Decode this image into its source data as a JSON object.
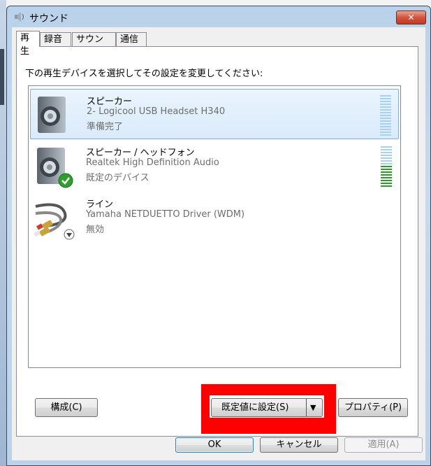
{
  "window": {
    "title": "サウンド",
    "close_label": "✕"
  },
  "tabs": [
    {
      "label": "再生",
      "active": true
    },
    {
      "label": "録音",
      "active": false
    },
    {
      "label": "サウンド",
      "active": false
    },
    {
      "label": "通信",
      "active": false
    }
  ],
  "instruction": "下の再生デバイスを選択してその設定を変更してください:",
  "devices": [
    {
      "name": "スピーカー",
      "description": "2- Logicool USB Headset H340",
      "status": "準備完了",
      "icon": "speaker-icon",
      "selected": true,
      "level": 0
    },
    {
      "name": "スピーカー / ヘッドフォン",
      "description": "Realtek High Definition Audio",
      "status": "既定のデバイス",
      "icon": "speaker-icon",
      "selected": false,
      "level": 0.55,
      "badge": "default-check-icon"
    },
    {
      "name": "ライン",
      "description": "Yamaha NETDUETTO Driver (WDM)",
      "status": "無効",
      "icon": "rca-cable-icon",
      "selected": false,
      "badge": "disabled-down-arrow-icon"
    }
  ],
  "buttons": {
    "configure": "構成(C)",
    "set_default": "既定値に設定(S)",
    "set_default_arrow": "▼",
    "properties": "プロパティ(P)",
    "ok": "OK",
    "cancel": "キャンセル",
    "apply": "適用(A)"
  },
  "colors": {
    "highlight": "#ff0000",
    "meter_active": "#2e9a2e",
    "meter_idle": "#a9d2ea",
    "selection": "#d9ebfb"
  }
}
